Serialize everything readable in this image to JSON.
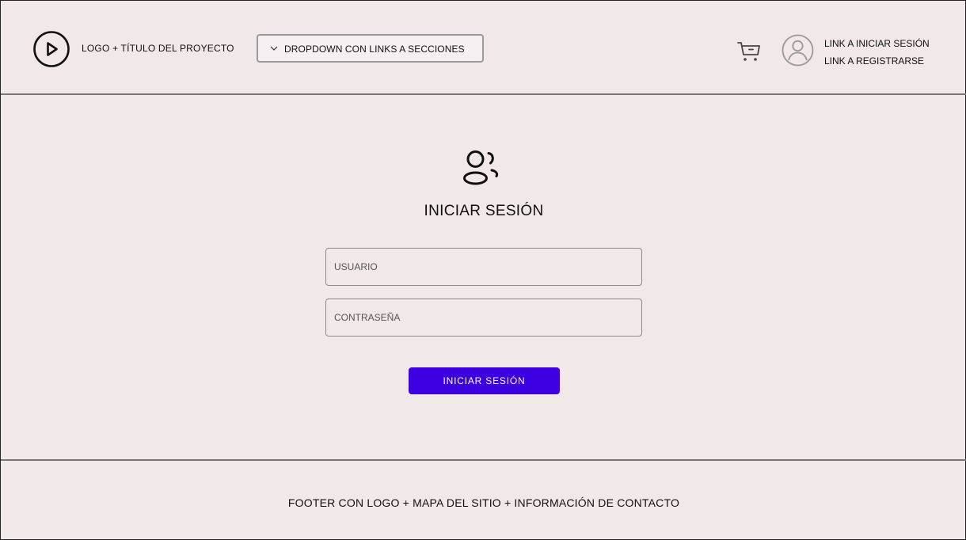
{
  "header": {
    "logo_title": "LOGO + TÍTULO DEL PROYECTO",
    "dropdown_label": "DROPDOWN CON LINKS A SECCIONES",
    "cart_icon": "cart-icon",
    "avatar_icon": "user-circle-icon",
    "login_link": "LINK A INICIAR SESIÓN",
    "register_link": "LINK A REGISTRARSE"
  },
  "main": {
    "icon": "users-icon",
    "title": "INICIAR SESIÓN",
    "username_placeholder": "USUARIO",
    "password_placeholder": "CONTRASEÑA",
    "submit_label": "INICIAR SESIÓN"
  },
  "footer": {
    "text": "FOOTER CON LOGO + MAPA DEL SITIO + INFORMACIÓN DE CONTACTO"
  },
  "colors": {
    "background": "#f0e8e9",
    "primary_button": "#3d00e0"
  }
}
